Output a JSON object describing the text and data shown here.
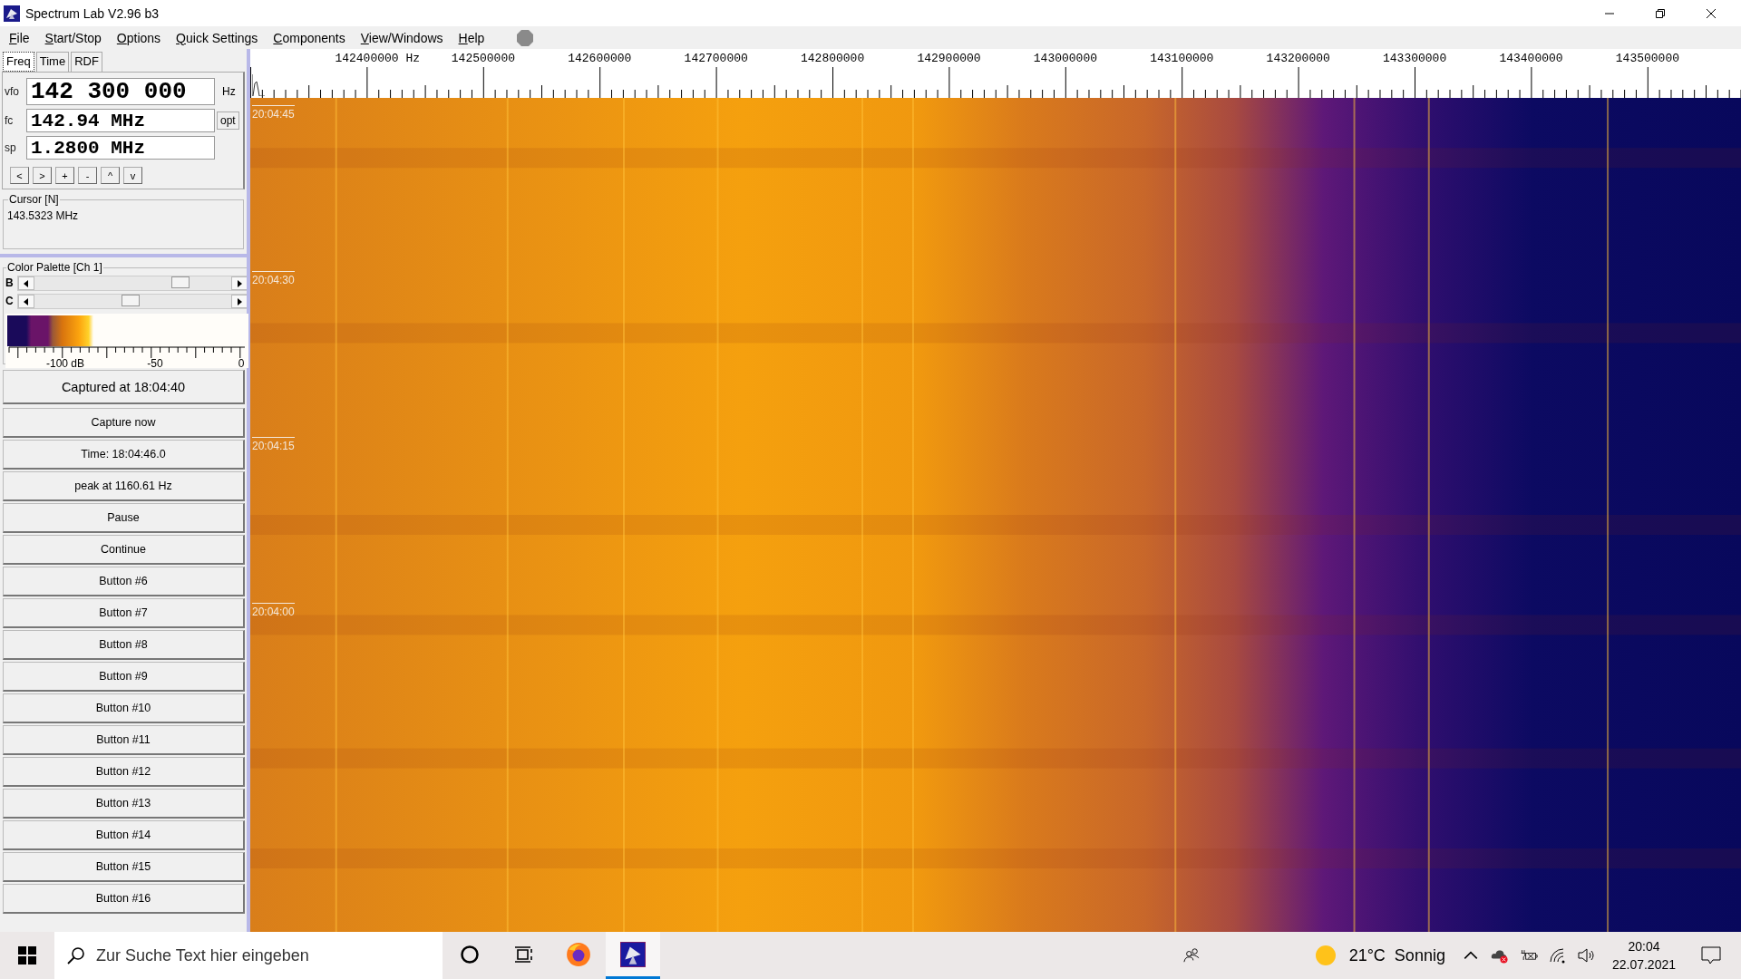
{
  "window": {
    "title": "Spectrum Lab V2.96 b3"
  },
  "menu": [
    "File",
    "Start/Stop",
    "Options",
    "Quick Settings",
    "Components",
    "View/Windows",
    "Help"
  ],
  "tabs": [
    {
      "label": "Freq",
      "selected": true
    },
    {
      "label": "Time",
      "selected": false
    },
    {
      "label": "RDF",
      "selected": false
    }
  ],
  "vfo": {
    "label": "vfo",
    "value": "142 300 000",
    "unit": "Hz"
  },
  "fc": {
    "label": "fc",
    "value": "142.94 MHz",
    "button": "opt"
  },
  "sp": {
    "label": "sp",
    "value": "1.2800 MHz"
  },
  "nav_buttons": [
    "<",
    ">",
    "+",
    "-",
    "^",
    "v"
  ],
  "cursor": {
    "title": "Cursor [N]",
    "value": "143.5323 MHz"
  },
  "color_palette": {
    "title": "Color Palette [Ch 1]",
    "sliders": [
      {
        "label": "B",
        "level": 0.74
      },
      {
        "label": "C",
        "level": 0.49
      }
    ],
    "scale_labels": [
      "-100 dB",
      "-50",
      "0"
    ]
  },
  "buttons": [
    "Captured at 18:04:40",
    "Capture now",
    "Time:  18:04:46.0",
    "peak at 1160.61 Hz",
    "Pause",
    "Continue",
    "Button #6",
    "Button #7",
    "Button #8",
    "Button #9",
    "Button #10",
    "Button #11",
    "Button #12",
    "Button #13",
    "Button #14",
    "Button #15",
    "Button #16"
  ],
  "frequency_ruler": [
    "142400000 Hz",
    "142500000",
    "142600000",
    "142700000",
    "142800000",
    "142900000",
    "143000000",
    "143100000",
    "143200000",
    "143300000",
    "143400000",
    "143500000"
  ],
  "time_labels": [
    "20:04:45",
    "20:04:30",
    "20:04:15",
    "20:04:00"
  ],
  "taskbar": {
    "search_placeholder": "Zur Suche Text hier eingeben",
    "apps": [
      {
        "kind": "cortana",
        "selected": false
      },
      {
        "kind": "task-view",
        "selected": false
      },
      {
        "kind": "firefox",
        "selected": false
      },
      {
        "kind": "spectrum-lab",
        "selected": true
      }
    ],
    "weather": "21°C  Sonnig",
    "time": "20:04",
    "date": "22.07.2021"
  }
}
